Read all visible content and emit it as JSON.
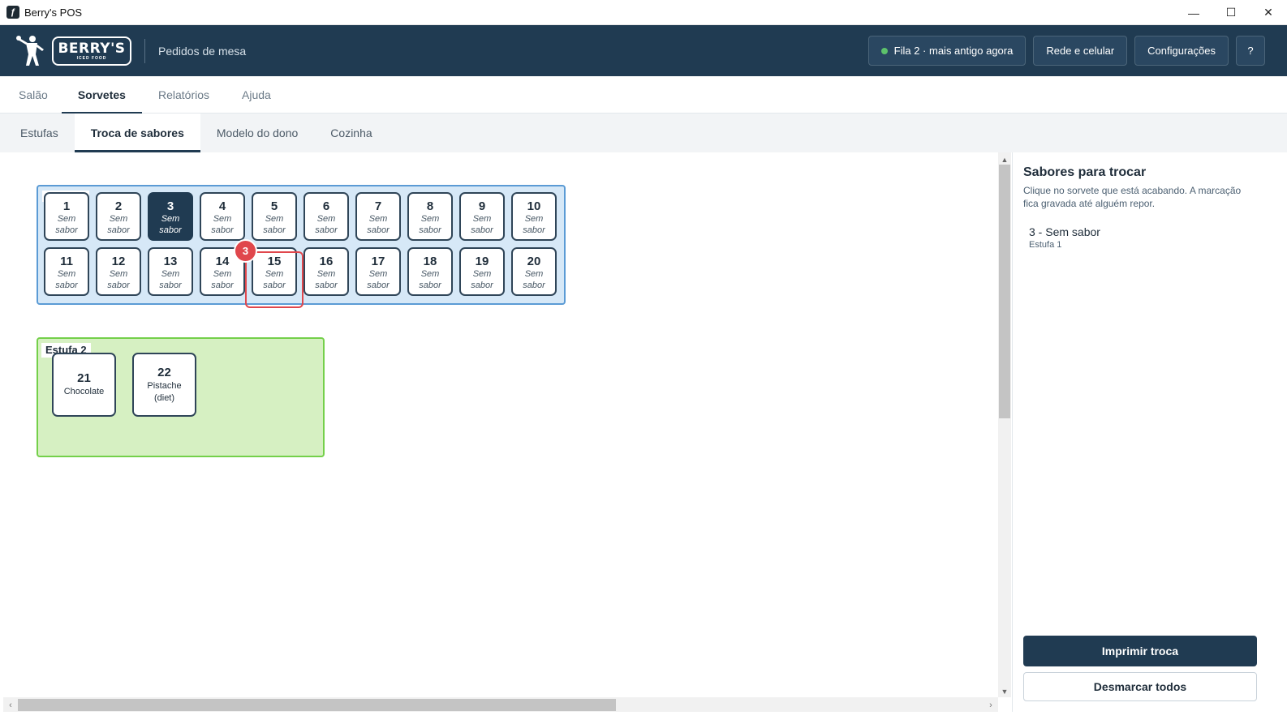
{
  "window": {
    "title": "Berry's POS",
    "controls": [
      "—",
      "☐",
      "✕"
    ]
  },
  "header": {
    "logo_word": "BERRY'S",
    "logo_sub": "ICED FOOD",
    "title": "Pedidos de mesa",
    "status_label": "Fila 2 · mais antigo agora",
    "status_color": "#5dc26b",
    "network_label": "Rede e celular",
    "settings_label": "Configurações",
    "help_label": "?"
  },
  "main_tabs": [
    {
      "label": "Salão",
      "active": false
    },
    {
      "label": "Sorvetes",
      "active": true
    },
    {
      "label": "Relatórios",
      "active": false
    },
    {
      "label": "Ajuda",
      "active": false
    }
  ],
  "sub_tabs": [
    {
      "label": "Estufas",
      "active": false
    },
    {
      "label": "Troca de sabores",
      "active": true
    },
    {
      "label": "Modelo do dono",
      "active": false
    },
    {
      "label": "Cozinha",
      "active": false
    }
  ],
  "estufa1": {
    "slots": [
      {
        "num": "1",
        "flavor_a": "Sem",
        "flavor_b": "sabor"
      },
      {
        "num": "2",
        "flavor_a": "Sem",
        "flavor_b": "sabor"
      },
      {
        "num": "3",
        "flavor_a": "Sem",
        "flavor_b": "sabor",
        "selected": true
      },
      {
        "num": "4",
        "flavor_a": "Sem",
        "flavor_b": "sabor"
      },
      {
        "num": "5",
        "flavor_a": "Sem",
        "flavor_b": "sabor"
      },
      {
        "num": "6",
        "flavor_a": "Sem",
        "flavor_b": "sabor"
      },
      {
        "num": "7",
        "flavor_a": "Sem",
        "flavor_b": "sabor"
      },
      {
        "num": "8",
        "flavor_a": "Sem",
        "flavor_b": "sabor"
      },
      {
        "num": "9",
        "flavor_a": "Sem",
        "flavor_b": "sabor"
      },
      {
        "num": "10",
        "flavor_a": "Sem",
        "flavor_b": "sabor"
      },
      {
        "num": "11",
        "flavor_a": "Sem",
        "flavor_b": "sabor"
      },
      {
        "num": "12",
        "flavor_a": "Sem",
        "flavor_b": "sabor"
      },
      {
        "num": "13",
        "flavor_a": "Sem",
        "flavor_b": "sabor"
      },
      {
        "num": "14",
        "flavor_a": "Sem",
        "flavor_b": "sabor"
      },
      {
        "num": "15",
        "flavor_a": "Sem",
        "flavor_b": "sabor"
      },
      {
        "num": "16",
        "flavor_a": "Sem",
        "flavor_b": "sabor"
      },
      {
        "num": "17",
        "flavor_a": "Sem",
        "flavor_b": "sabor"
      },
      {
        "num": "18",
        "flavor_a": "Sem",
        "flavor_b": "sabor"
      },
      {
        "num": "19",
        "flavor_a": "Sem",
        "flavor_b": "sabor"
      },
      {
        "num": "20",
        "flavor_a": "Sem",
        "flavor_b": "sabor"
      }
    ]
  },
  "estufa2": {
    "label": "Estufa 2",
    "slots": [
      {
        "num": "21",
        "flavor_a": "Chocolate",
        "flavor_b": ""
      },
      {
        "num": "22",
        "flavor_a": "Pistache",
        "flavor_b": "(diet)"
      }
    ]
  },
  "annotation": {
    "badge": "3"
  },
  "panel": {
    "title": "Sabores para trocar",
    "description": "Clique no sorvete que está acabando. A marcação fica gravada até alguém repor.",
    "items": [
      {
        "title": "3 - Sem sabor",
        "subtitle": "Estufa 1"
      }
    ],
    "print_label": "Imprimir troca",
    "clear_label": "Desmarcar todos"
  }
}
